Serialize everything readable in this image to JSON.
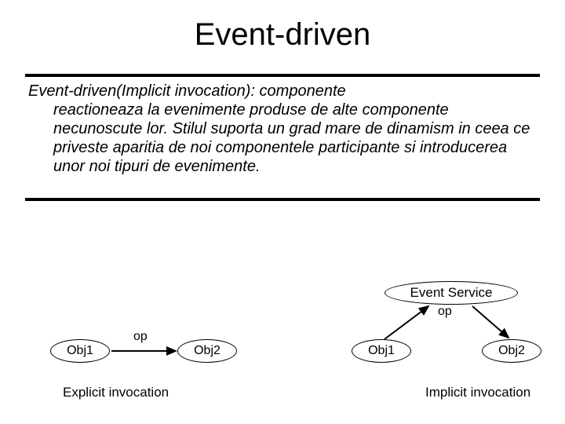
{
  "title": "Event-driven",
  "body": {
    "lead": "Event-driven(Implicit invocation): componente",
    "rest": "reactioneaza la evenimente produse de alte componente necunoscute lor. Stilul suporta un grad mare de dinamism in ceea ce priveste aparitia de noi componentele participante si introducerea unor noi tipuri de evenimente."
  },
  "diagram": {
    "event_service": "Event Service",
    "op_left": "op",
    "op_right": "op",
    "left_obj1": "Obj1",
    "left_obj2": "Obj2",
    "right_obj1": "Obj1",
    "right_obj2": "Obj2",
    "caption_left": "Explicit invocation",
    "caption_right": "Implicit invocation"
  }
}
